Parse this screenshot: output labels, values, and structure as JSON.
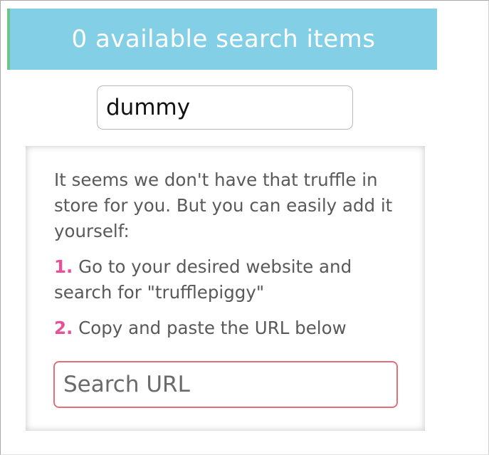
{
  "header": {
    "title": "0 available search items"
  },
  "search": {
    "value": "dummy"
  },
  "empty_state": {
    "intro": "It seems we don't have that truffle in store for you. But you can easily add it yourself:",
    "steps": [
      {
        "number": "1.",
        "text": "Go to your desired website and search for \"trufflepiggy\""
      },
      {
        "number": "2.",
        "text": "Copy and paste the URL below"
      }
    ],
    "url_input": {
      "placeholder": "Search URL"
    }
  },
  "colors": {
    "header_bg": "#83cfe6",
    "header_accent": "#6fc48a",
    "step_number": "#e8519a",
    "url_input_border": "#e0717b"
  }
}
